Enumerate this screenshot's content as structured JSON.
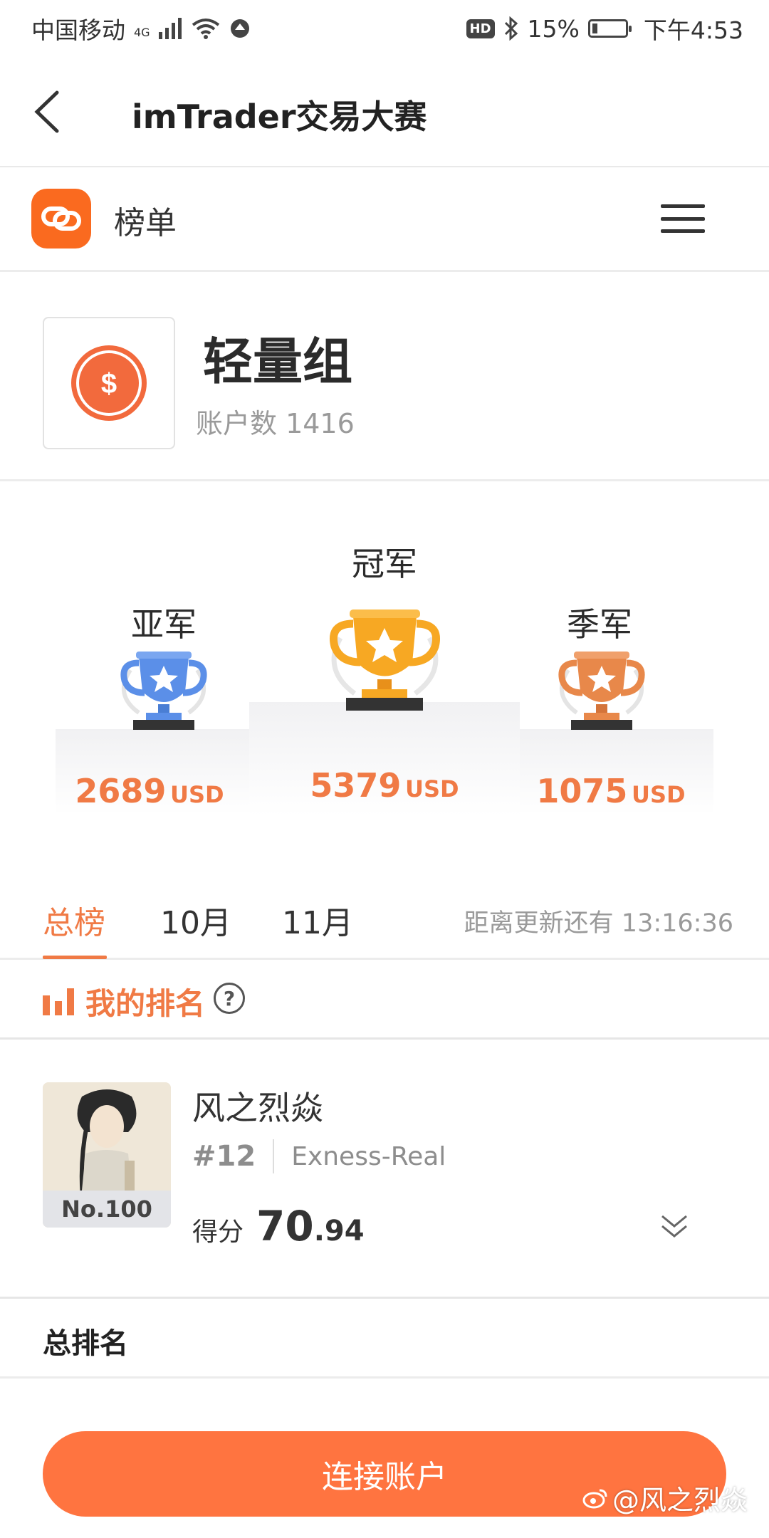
{
  "status_bar": {
    "carrier": "中国移动",
    "network": "4G",
    "hd": "HD",
    "battery": "15%",
    "battery_level": 0.15,
    "time": "下午4:53"
  },
  "nav": {
    "title": "imTrader交易大赛"
  },
  "rank_header": {
    "title": "榜单"
  },
  "group": {
    "name": "轻量组",
    "account_count": "账户数 1416"
  },
  "podium": {
    "first": {
      "label": "冠军",
      "amount": "5379",
      "unit": "USD"
    },
    "second": {
      "label": "亚军",
      "amount": "2689",
      "unit": "USD"
    },
    "third": {
      "label": "季军",
      "amount": "1075",
      "unit": "USD"
    }
  },
  "tabs": {
    "items": [
      {
        "label": "总榜",
        "active": true
      },
      {
        "label": "10月"
      },
      {
        "label": "11月"
      }
    ],
    "countdown": "距离更新还有 13:16:36"
  },
  "my_rank": {
    "title": "我的排名",
    "help": "?",
    "user_name": "风之烈焱",
    "badge": "No.100",
    "rank": "#12",
    "broker": "Exness-Real",
    "score_label": "得分",
    "score_int": "70",
    "score_dec": ".94"
  },
  "total_rank": {
    "title": "总排名"
  },
  "bottom": {
    "connect_button": "连接账户",
    "watermark": "@风之烈焱"
  },
  "colors": {
    "accent": "#f07a45",
    "button": "#ff7440",
    "gold": "#f7a823",
    "silver_blue": "#5b8fe8",
    "bronze": "#e8884a"
  },
  "icons": {
    "back": "chevron-left-icon",
    "menu": "hamburger-menu-icon",
    "logo": "link-logo-icon",
    "group": "dollar-coin-icon",
    "trophy": "trophy-icon",
    "bars": "bar-chart-icon",
    "help": "question-circle-icon",
    "expand": "double-chevron-down-icon"
  }
}
